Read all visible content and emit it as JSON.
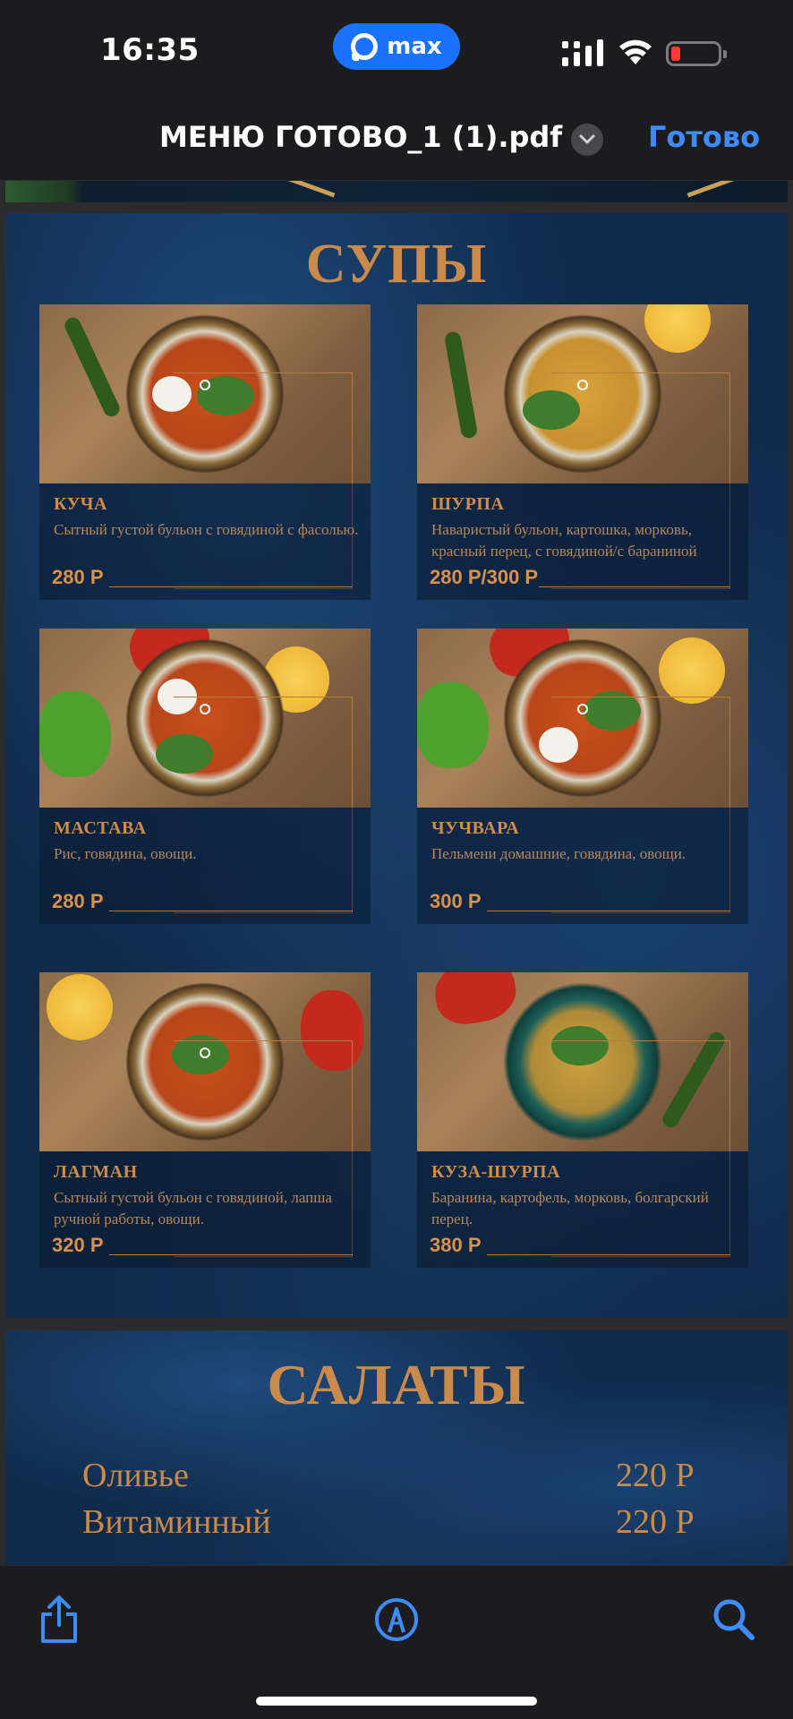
{
  "status_bar": {
    "time": "16:35",
    "app_badge": "max",
    "battery_color": "#ff3b30"
  },
  "nav": {
    "title": "МЕНЮ ГОТОВО_1 (1).pdf",
    "done_label": "Готово",
    "accent_color": "#3d8bfd"
  },
  "soups": {
    "title": "СУПЫ",
    "items": [
      {
        "name": "КУЧА",
        "desc": "Сытный густой бульон с говядиной с фасолью.",
        "price": "280 Р"
      },
      {
        "name": "ШУРПА",
        "desc": "Наваристый бульон, картошка, морковь, красный перец, с говядиной/с бараниной",
        "price": "280 Р/300 Р"
      },
      {
        "name": "МАСТАВА",
        "desc": "Рис, говядина, овощи.",
        "price": "280 Р"
      },
      {
        "name": "ЧУЧВАРА",
        "desc": "Пельмени домашние, говядина, овощи.",
        "price": "300 Р"
      },
      {
        "name": "ЛАГМАН",
        "desc": "Сытный густой бульон с говядиной, лапша ручной работы, овощи.",
        "price": "320 Р"
      },
      {
        "name": "КУЗА-ШУРПА",
        "desc": "Баранина, картофель, морковь, болгарский перец.",
        "price": "380 Р"
      }
    ]
  },
  "salads": {
    "title": "САЛАТЫ",
    "items": [
      {
        "name": "Оливье",
        "price": "220 Р"
      },
      {
        "name": "Витаминный",
        "price": "220 Р"
      }
    ]
  },
  "toolbar": {
    "share_icon": "share-icon",
    "markup_icon": "markup-pen-icon",
    "search_icon": "search-icon"
  }
}
